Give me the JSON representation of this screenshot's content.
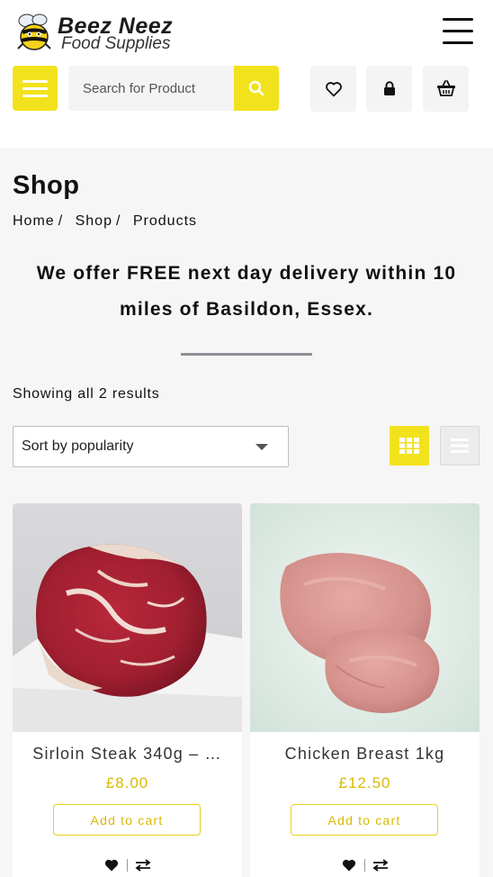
{
  "header": {
    "logo_line1": "Beez Neez",
    "logo_line2": "Food Supplies",
    "menu_icon": "hamburger-icon",
    "categories_icon": "hamburger-icon",
    "search": {
      "placeholder": "Search for Product",
      "button_icon": "search-icon"
    },
    "actions": [
      {
        "name": "wishlist",
        "icon": "heart-outline-icon"
      },
      {
        "name": "account",
        "icon": "lock-icon"
      },
      {
        "name": "cart",
        "icon": "basket-icon"
      }
    ],
    "accent_color": "#f2e21d"
  },
  "page": {
    "title": "Shop",
    "breadcrumb": [
      "Home",
      "Shop",
      "Products"
    ],
    "breadcrumb_sep": "/",
    "delivery_notice": "We offer FREE next day delivery within 10 miles of Basildon, Essex.",
    "results_text": "Showing all 2 results",
    "sort": {
      "selected": "Sort by popularity"
    },
    "view_modes": [
      {
        "name": "grid",
        "icon": "grid-icon",
        "active": true
      },
      {
        "name": "list",
        "icon": "list-icon",
        "active": false
      }
    ]
  },
  "products": [
    {
      "name": "Sirloin Steak 340g – …",
      "price": "£8.00",
      "button": "Add to cart",
      "image": "steak-photo",
      "wishlist_icon": "heart-icon",
      "compare_icon": "compare-arrows-icon"
    },
    {
      "name": "Chicken Breast 1kg",
      "price": "£12.50",
      "button": "Add to cart",
      "image": "chicken-photo",
      "wishlist_icon": "heart-icon",
      "compare_icon": "compare-arrows-icon"
    }
  ]
}
